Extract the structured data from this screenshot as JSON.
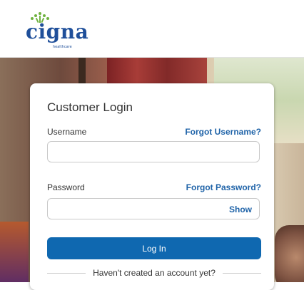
{
  "brand": {
    "name": "cigna",
    "sub": "healthcare",
    "colors": {
      "word": "#1f4f9a",
      "leaf": "#6fb23f"
    }
  },
  "login": {
    "title": "Customer Login",
    "username_label": "Username",
    "forgot_username": "Forgot Username?",
    "username_value": "",
    "password_label": "Password",
    "forgot_password": "Forgot Password?",
    "password_value": "",
    "show_label": "Show",
    "login_button": "Log In",
    "no_account_text": "Haven't created an account yet?"
  },
  "colors": {
    "primary": "#0f68b0",
    "link": "#1f63a8"
  }
}
